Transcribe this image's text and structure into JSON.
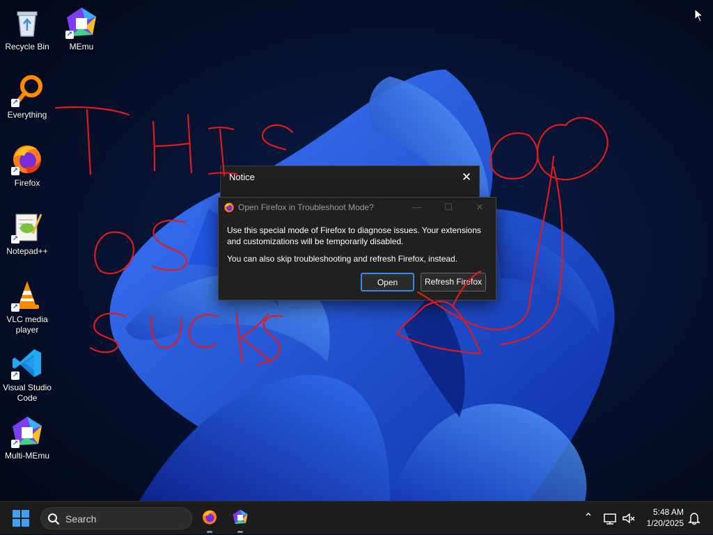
{
  "desktop": {
    "icons": [
      {
        "label": "Recycle Bin",
        "icon": "recycle-bin-icon"
      },
      {
        "label": "MEmu",
        "icon": "memu-icon"
      },
      {
        "label": "Everything",
        "icon": "everything-search-icon"
      },
      {
        "label": "Firefox",
        "icon": "firefox-icon"
      },
      {
        "label": "Notepad++",
        "icon": "notepad-plus-plus-icon"
      },
      {
        "label": "VLC media player",
        "icon": "vlc-cone-icon"
      },
      {
        "label": "Visual Studio Code",
        "icon": "vscode-icon"
      },
      {
        "label": "Multi-MEmu",
        "icon": "multi-memu-icon"
      }
    ],
    "scribble_color": "#e01b1b"
  },
  "notice_dialog": {
    "title": "Notice",
    "close_glyph": "✕"
  },
  "firefox_dialog": {
    "title": "Open Firefox in Troubleshoot Mode?",
    "minimize_glyph": "—",
    "maximize_glyph": "☐",
    "close_glyph": "✕",
    "message_1": "Use this special mode of Firefox to diagnose issues. Your extensions and customizations will be temporarily disabled.",
    "message_2": "You can also skip troubleshooting and refresh Firefox, instead.",
    "open_button": "Open",
    "refresh_button": "Refresh Firefox",
    "accent_color": "#3a8ae0"
  },
  "taskbar": {
    "search_placeholder": "Search",
    "pinned": [
      "firefox-icon",
      "memu-icon"
    ],
    "tray": {
      "chevron_glyph": "⌃",
      "network_icon": "network-icon",
      "volume_icon": "volume-muted-icon",
      "notification_icon": "bell-icon"
    },
    "clock": {
      "time": "5:48 AM",
      "date": "1/20/2025"
    }
  }
}
